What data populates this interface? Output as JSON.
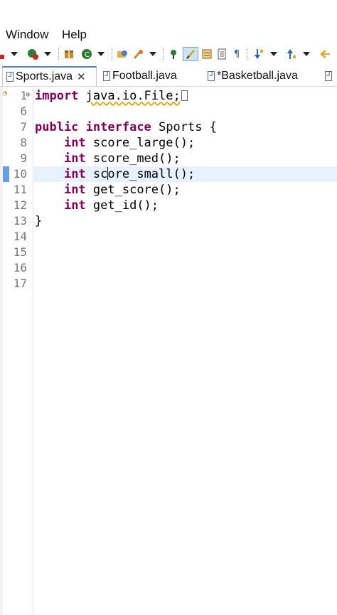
{
  "menu": {
    "window": "Window",
    "help": "Help"
  },
  "tabs": [
    {
      "label": "Sports.java",
      "active": true,
      "closable": true
    },
    {
      "label": "Football.java",
      "active": false
    },
    {
      "label": "*Basketball.java",
      "active": false
    }
  ],
  "editor": {
    "lines": [
      {
        "num": "1",
        "code": "import java.io.File;"
      },
      {
        "num": "6",
        "code": ""
      },
      {
        "num": "7",
        "code": "public interface Sports {"
      },
      {
        "num": "8",
        "code": "    int score_large();"
      },
      {
        "num": "9",
        "code": "    int score_med();"
      },
      {
        "num": "10",
        "code": "    int score_small();"
      },
      {
        "num": "11",
        "code": "    int get_score();"
      },
      {
        "num": "12",
        "code": "    int get_id();"
      },
      {
        "num": "13",
        "code": "}"
      },
      {
        "num": "14",
        "code": ""
      },
      {
        "num": "15",
        "code": ""
      },
      {
        "num": "16",
        "code": ""
      },
      {
        "num": "17",
        "code": ""
      }
    ],
    "current_line": "10"
  },
  "colors": {
    "keyword": "#7f0055",
    "current_line_bg": "#e8f2fe",
    "tab_accent": "#4a7fc1"
  }
}
